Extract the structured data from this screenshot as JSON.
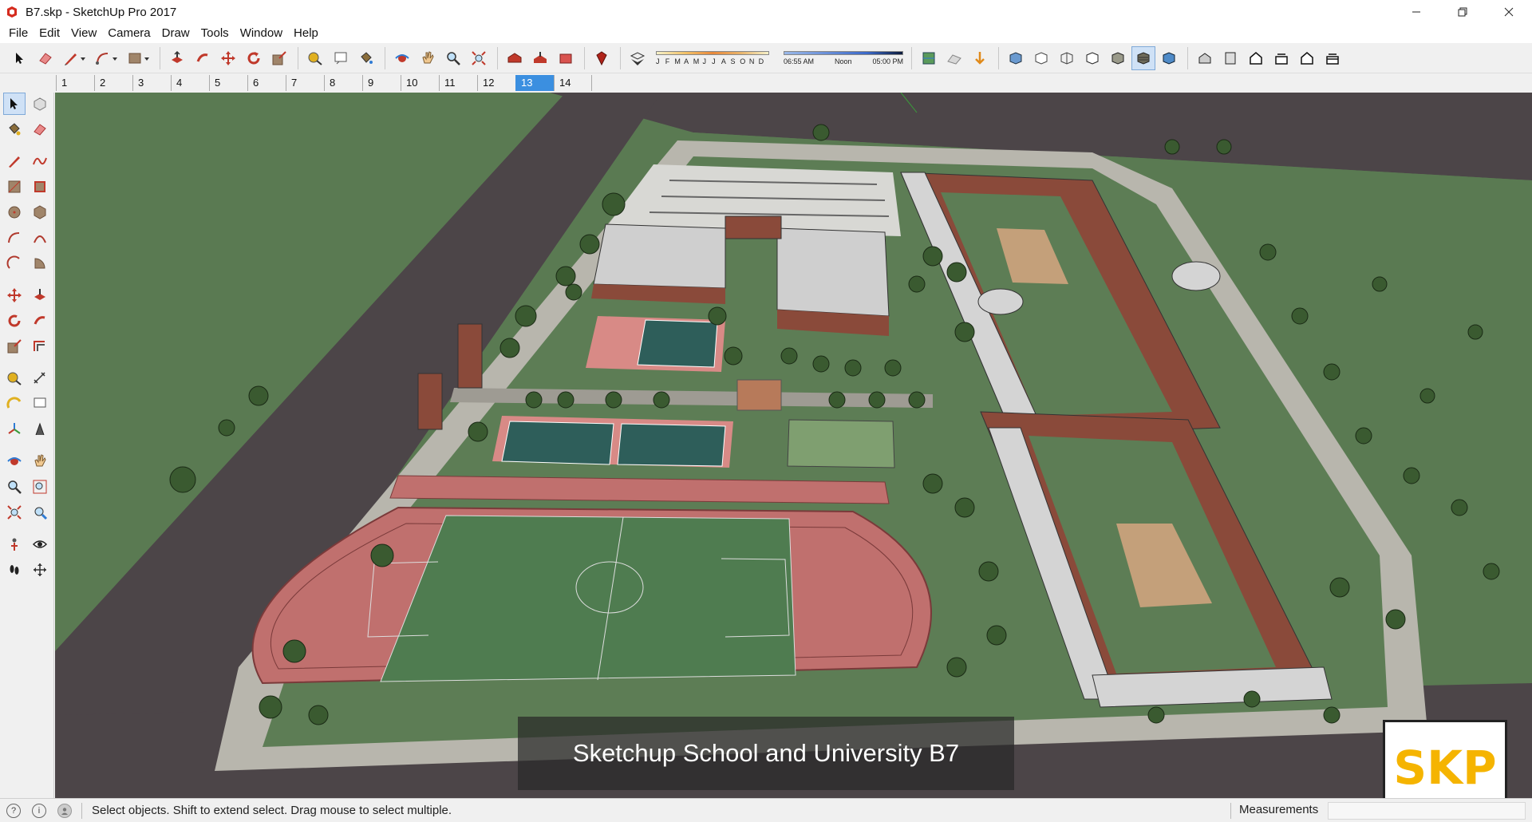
{
  "window": {
    "title": "B7.skp - SketchUp Pro 2017",
    "controls": [
      "minimize",
      "restore",
      "close"
    ]
  },
  "menu": [
    "File",
    "Edit",
    "View",
    "Camera",
    "Draw",
    "Tools",
    "Window",
    "Help"
  ],
  "toolbar": {
    "shadow_months": [
      "J",
      "F",
      "M",
      "A",
      "M",
      "J",
      "J",
      "A",
      "S",
      "O",
      "N",
      "D"
    ],
    "shadow_time_start": "06:55 AM",
    "shadow_time_mid": "Noon",
    "shadow_time_end": "05:00 PM"
  },
  "scenes": {
    "tabs": [
      "1",
      "2",
      "3",
      "4",
      "5",
      "6",
      "7",
      "8",
      "9",
      "10",
      "11",
      "12",
      "13",
      "14"
    ],
    "active": "13"
  },
  "viewport": {
    "caption": "Sketchup School and University B7",
    "logo_text": "SKP"
  },
  "status": {
    "hint": "Select objects. Shift to extend select. Drag mouse to select multiple.",
    "measurements_label": "Measurements",
    "measurements_value": ""
  },
  "colors": {
    "grass": "#5a7a52",
    "road": "#4c4548",
    "track": "#c0706e",
    "field": "#4f7c50",
    "court": "#2e5e5a",
    "brick": "#8a4a3a",
    "roof": "#cfcfcf",
    "scene_active": "#3b8fe0",
    "logo": "#f5b400"
  }
}
